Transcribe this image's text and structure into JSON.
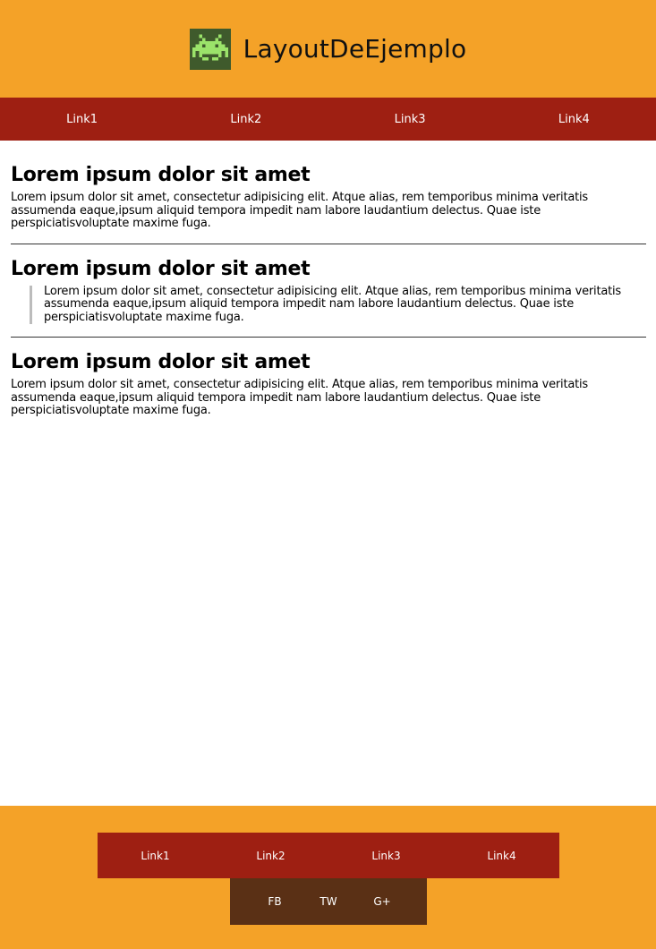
{
  "header": {
    "title": "LayoutDeEjemplo",
    "logo_icon": "space-invader-icon",
    "background": "#f4a228"
  },
  "nav": {
    "links": [
      "Link1",
      "Link2",
      "Link3",
      "Link4"
    ],
    "background": "#9e1f12"
  },
  "articles": [
    {
      "heading": "Lorem ipsum dolor sit amet",
      "body": "Lorem ipsum dolor sit amet, consectetur adipisicing elit. Atque alias, rem temporibus minima veritatis assumenda eaque,ipsum aliquid tempora impedit nam labore laudantium delectus. Quae iste perspiciatisvoluptate maxime fuga."
    },
    {
      "heading": "Lorem ipsum dolor sit amet",
      "quote": "Lorem ipsum dolor sit amet, consectetur adipisicing elit. Atque alias, rem temporibus minima veritatis assumenda eaque,ipsum aliquid tempora impedit nam labore laudantium delectus. Quae iste perspiciatisvoluptate maxime fuga."
    },
    {
      "heading": "Lorem ipsum dolor sit amet",
      "body": "Lorem ipsum dolor sit amet, consectetur adipisicing elit. Atque alias, rem temporibus minima veritatis assumenda eaque,ipsum aliquid tempora impedit nam labore laudantium delectus. Quae iste perspiciatisvoluptate maxime fuga."
    }
  ],
  "footer": {
    "links": [
      "Link1",
      "Link2",
      "Link3",
      "Link4"
    ],
    "social": [
      "FB",
      "TW",
      "G+"
    ],
    "social_background": "#5a3015"
  }
}
